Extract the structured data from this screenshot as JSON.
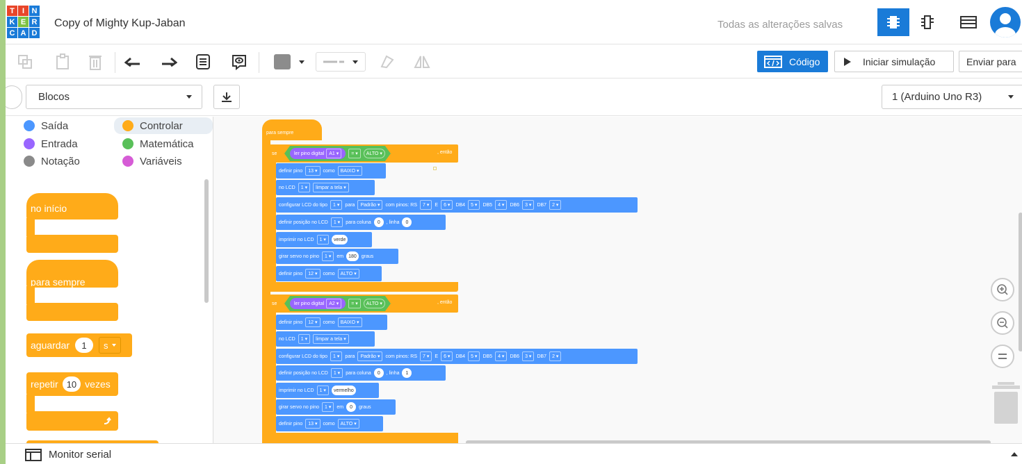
{
  "header": {
    "logo_letters": [
      "T",
      "I",
      "N",
      "K",
      "E",
      "R",
      "C",
      "A",
      "D"
    ],
    "logo_colors": [
      "#e8462a",
      "#e8462a",
      "#1a7bd8",
      "#1a7bd8",
      "#7ec242",
      "#1a7bd8",
      "#1a7bd8",
      "#1a7bd8",
      "#1a7bd8"
    ],
    "title": "Copy of Mighty Kup-Jaban",
    "save_status": "Todas as alterações salvas",
    "views": [
      "circuit-view-icon",
      "schematic-view-icon",
      "component-list-icon"
    ]
  },
  "toolbar": {
    "code_label": "Código",
    "simulate_label": "Iniciar simulação",
    "send_label": "Enviar para"
  },
  "editor": {
    "mode_select": "Blocos",
    "board_select": "1 (Arduino Uno R3)"
  },
  "categories": [
    {
      "label": "Saída",
      "color": "#4c97ff"
    },
    {
      "label": "Controlar",
      "color": "#ffab19"
    },
    {
      "label": "Entrada",
      "color": "#9966ff"
    },
    {
      "label": "Matemática",
      "color": "#59c059"
    },
    {
      "label": "Notação",
      "color": "#8a8a8a"
    },
    {
      "label": "Variáveis",
      "color": "#d65cd6"
    }
  ],
  "palette": {
    "start": "no início",
    "forever": "para sempre",
    "wait": "aguardar",
    "wait_value": "1",
    "wait_unit": "s",
    "repeat": "repetir",
    "repeat_value": "10",
    "repeat_times": "vezes"
  },
  "script": {
    "forever_label": "para sempre",
    "if1": {
      "kw": "se",
      "read": "ler pino digital",
      "pin": "A1",
      "op": "=",
      "val": "ALTO",
      "then": ", então"
    },
    "body1": {
      "set_pin": {
        "a": "definir pino",
        "pin": "13",
        "b": "como",
        "val": "BAIXO"
      },
      "lcd_clear": {
        "a": "no LCD",
        "n": "1",
        "b": "limpar a tela"
      },
      "lcd_config": {
        "a": "configurar LCD do tipo",
        "n": "1",
        "b": "para",
        "type": "Padrão",
        "c": "com pinos: RS",
        "rs": "7",
        "e_lbl": "E",
        "e": "6",
        "db4_lbl": "DB4",
        "db4": "5",
        "db5_lbl": "DB5",
        "db5": "4",
        "db6_lbl": "DB6",
        "db6": "3",
        "db7_lbl": "DB7",
        "db7": "2"
      },
      "lcd_pos": {
        "a": "definir posição no LCD",
        "n": "1",
        "b": "para coluna",
        "col": "0",
        "c": ", linha",
        "row": "0"
      },
      "print": {
        "a": "imprimir no LCD",
        "n": "1",
        "text": "verde"
      },
      "servo": {
        "a": "girar servo no pino",
        "pin": "1",
        "b": "em",
        "deg": "180",
        "c": "graus"
      },
      "set_pin2": {
        "a": "definir pino",
        "pin": "12",
        "b": "como",
        "val": "ALTO"
      }
    },
    "if2": {
      "kw": "se",
      "read": "ler pino digital",
      "pin": "A2",
      "op": "=",
      "val": "ALTO",
      "then": ", então"
    },
    "body2": {
      "set_pin": {
        "a": "definir pino",
        "pin": "12",
        "b": "como",
        "val": "BAIXO"
      },
      "lcd_clear": {
        "a": "no LCD",
        "n": "1",
        "b": "limpar a tela"
      },
      "lcd_config": {
        "a": "configurar LCD do tipo",
        "n": "1",
        "b": "para",
        "type": "Padrão",
        "c": "com pinos: RS",
        "rs": "7",
        "e_lbl": "E",
        "e": "6",
        "db4_lbl": "DB4",
        "db4": "5",
        "db5_lbl": "DB5",
        "db5": "4",
        "db6_lbl": "DB6",
        "db6": "3",
        "db7_lbl": "DB7",
        "db7": "2"
      },
      "lcd_pos": {
        "a": "definir posição no LCD",
        "n": "1",
        "b": "para coluna",
        "col": "0",
        "c": ", linha",
        "row": "1"
      },
      "print": {
        "a": "imprimir no LCD",
        "n": "1",
        "text": "vermelho"
      },
      "servo": {
        "a": "girar servo no pino",
        "pin": "1",
        "b": "em",
        "deg": "0",
        "c": "graus"
      },
      "set_pin2": {
        "a": "definir pino",
        "pin": "13",
        "b": "como",
        "val": "ALTO"
      }
    }
  },
  "zoom_controls": [
    "zoom-in-icon",
    "zoom-out-icon",
    "zoom-reset-icon"
  ],
  "monitor": {
    "label": "Monitor serial"
  }
}
